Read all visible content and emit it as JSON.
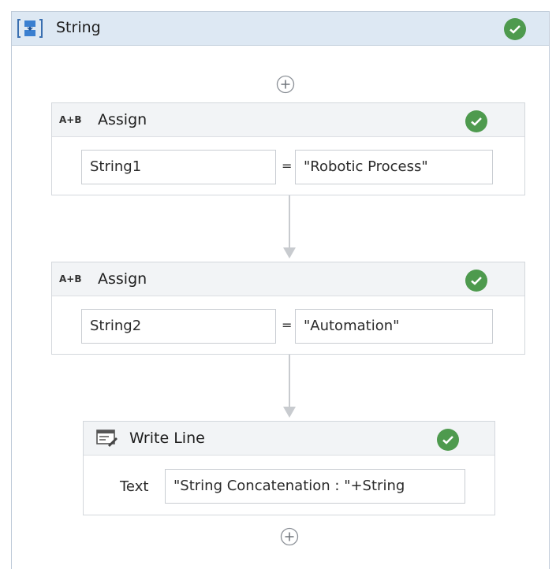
{
  "sequence": {
    "title": "String",
    "icon": "sequence-icon",
    "status_icon": "check-icon"
  },
  "assign1": {
    "icon_text": "A+B",
    "title": "Assign",
    "to": "String1",
    "operator": "=",
    "value": "\"Robotic Process\""
  },
  "assign2": {
    "icon_text": "A+B",
    "title": "Assign",
    "to": "String2",
    "operator": "=",
    "value": "\"Automation\""
  },
  "writeline": {
    "icon": "write-line-icon",
    "title": "Write Line",
    "text_label": "Text",
    "text_value": "\"String Concatenation : \"+String"
  },
  "colors": {
    "success": "#4e9a4e",
    "header_bg": "#dde8f3",
    "activity_header_bg": "#f2f4f6",
    "connector": "#c8cbcf"
  }
}
